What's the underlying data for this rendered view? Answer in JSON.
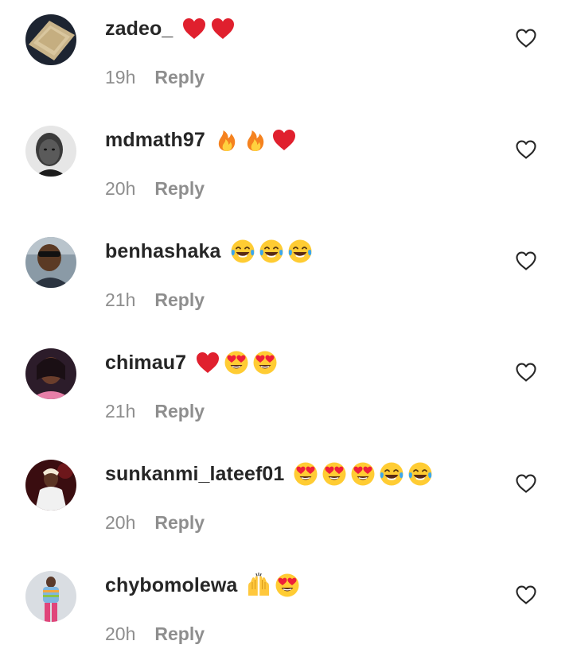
{
  "reply_label": "Reply",
  "comments": [
    {
      "username": "zadeo_",
      "time": "19h",
      "emojis": [
        "red-heart-icon",
        "red-heart-icon"
      ]
    },
    {
      "username": "mdmath97",
      "time": "20h",
      "emojis": [
        "fire-icon",
        "fire-icon",
        "red-heart-icon"
      ]
    },
    {
      "username": "benhashaka",
      "time": "21h",
      "emojis": [
        "tears-of-joy-icon",
        "tears-of-joy-icon",
        "tears-of-joy-icon"
      ]
    },
    {
      "username": "chimau7",
      "time": "21h",
      "emojis": [
        "red-heart-icon",
        "heart-eyes-icon",
        "heart-eyes-icon"
      ]
    },
    {
      "username": "sunkanmi_lateef01",
      "time": "20h",
      "emojis": [
        "heart-eyes-icon",
        "heart-eyes-icon",
        "heart-eyes-icon",
        "tears-of-joy-icon",
        "tears-of-joy-icon"
      ]
    },
    {
      "username": "chybomolewa",
      "time": "20h",
      "emojis": [
        "raising-hands-icon",
        "heart-eyes-icon"
      ]
    }
  ],
  "colors": {
    "username": "#262626",
    "meta": "#8e8e8e",
    "heart_red": "#e0202e",
    "emoji_yellow": "#ffcc33"
  }
}
